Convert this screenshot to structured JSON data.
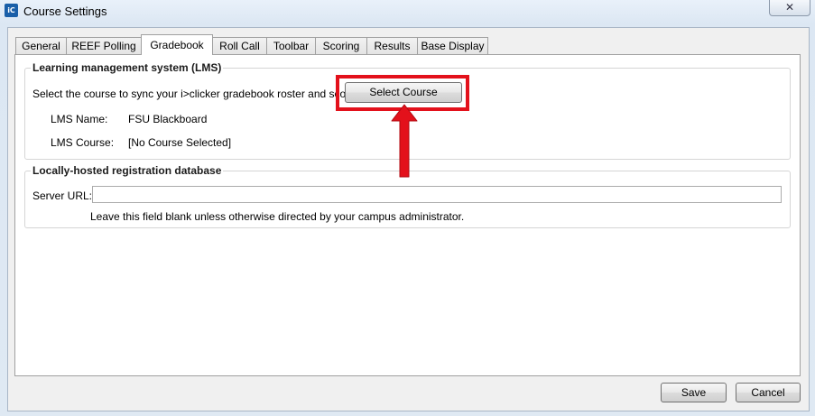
{
  "window": {
    "title": "Course Settings",
    "app_icon_text": "iC",
    "close_glyph": "✕"
  },
  "tabs": [
    {
      "label": "General",
      "active": false
    },
    {
      "label": "REEF Polling",
      "active": false
    },
    {
      "label": "Gradebook",
      "active": true
    },
    {
      "label": "Roll Call",
      "active": false
    },
    {
      "label": "Toolbar",
      "active": false
    },
    {
      "label": "Scoring",
      "active": false
    },
    {
      "label": "Results",
      "active": false
    },
    {
      "label": "Base Display",
      "active": false
    }
  ],
  "lms": {
    "group_title": "Learning management system (LMS)",
    "sync_prompt": "Select the course to sync your i>clicker gradebook roster and scores:",
    "select_course_label": "Select Course",
    "name_label": "LMS Name:",
    "name_value": "FSU Blackboard",
    "course_label": "LMS Course:",
    "course_value": "[No Course Selected]"
  },
  "registration": {
    "group_title": "Locally-hosted registration database",
    "server_url_label": "Server URL:",
    "server_url_value": "",
    "hint": "Leave this field blank unless otherwise directed by your campus administrator."
  },
  "footer": {
    "save_label": "Save",
    "cancel_label": "Cancel"
  },
  "annotation": {
    "color": "#e3111b"
  }
}
